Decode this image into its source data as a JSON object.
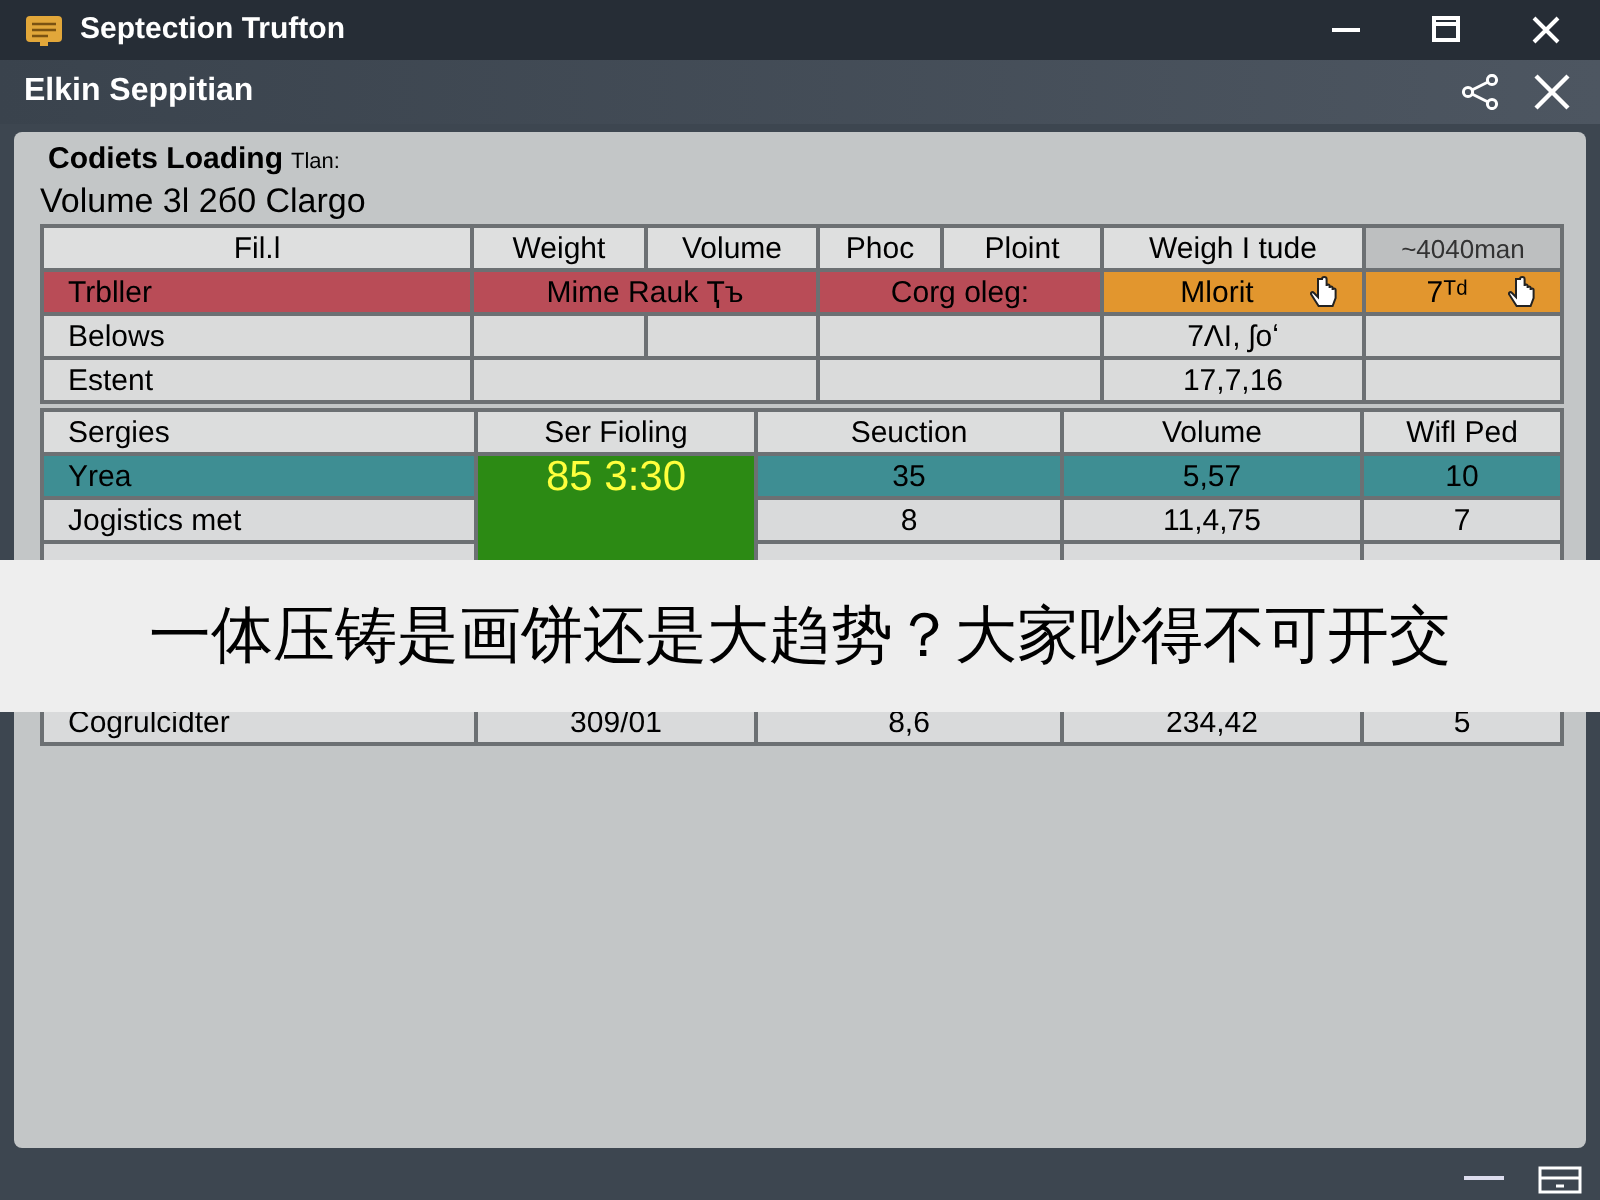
{
  "window": {
    "title": "Septection Trufton"
  },
  "header": {
    "title": "Elkin Seppitian"
  },
  "panel": {
    "heading": "Codiets Loading",
    "heading_note": "Tlan:",
    "subheading": "Volume 3l 2б0 Clargo"
  },
  "table_1": {
    "columns": [
      {
        "label": "Fil.l"
      },
      {
        "label": "Weight"
      },
      {
        "label": "Volume"
      },
      {
        "label": "Phoc"
      },
      {
        "label": "Ploint"
      },
      {
        "label": "Weigh I tude"
      },
      {
        "label": "~4040man",
        "kind": "muted"
      }
    ],
    "rows": [
      {
        "kind": "alert",
        "cells": [
          {
            "text": "Trbller"
          },
          {
            "text": "Mime Rauk Ҭъ",
            "colspan": 2
          },
          {
            "text": "Corg oleg:",
            "colspan": 2
          },
          {
            "text": "Mlorit",
            "kind": "warning",
            "pointer": true
          },
          {
            "text": "7ᵀᵈ",
            "kind": "warning",
            "pointer": true
          }
        ]
      },
      {
        "kind": "plain",
        "cells": [
          {
            "text": "Belows"
          },
          {
            "text": ""
          },
          {
            "text": ""
          },
          {
            "text": "",
            "colspan": 2
          },
          {
            "text": "7ɅӀ, ʃoʻ"
          },
          {
            "text": ""
          }
        ]
      },
      {
        "kind": "plain",
        "cells": [
          {
            "text": "Estent"
          },
          {
            "text": "",
            "colspan": 2
          },
          {
            "text": "",
            "colspan": 2
          },
          {
            "text": "17,7,16"
          },
          {
            "text": ""
          }
        ]
      }
    ]
  },
  "table_2": {
    "columns": [
      "Sergies",
      "Ser Fioling",
      "Seuction",
      "Volume",
      "Wifl Ped"
    ],
    "rows": [
      {
        "kind": "highlight",
        "cells": [
          {
            "text": "Yrea"
          },
          {
            "text": "85 3:30",
            "kind": "timer",
            "rowspan": 3
          },
          {
            "text": "35"
          },
          {
            "text": "5,57"
          },
          {
            "text": "10"
          }
        ]
      },
      {
        "kind": "plain",
        "cells": [
          {
            "text": "Jogistics met"
          },
          {
            "text": "8"
          },
          {
            "text": "11,4,75"
          },
          {
            "text": "7"
          }
        ]
      },
      {
        "kind": "covered"
      },
      {
        "kind": "plain",
        "cells": [
          {
            "text": "Cogrulcidter"
          },
          {
            "text": "309/01"
          },
          {
            "text": "8,6"
          },
          {
            "text": "234,42"
          },
          {
            "text": "5"
          }
        ]
      }
    ]
  },
  "banner": {
    "text": "一体压铸是画饼还是大趋势？大家吵得不可开交"
  }
}
